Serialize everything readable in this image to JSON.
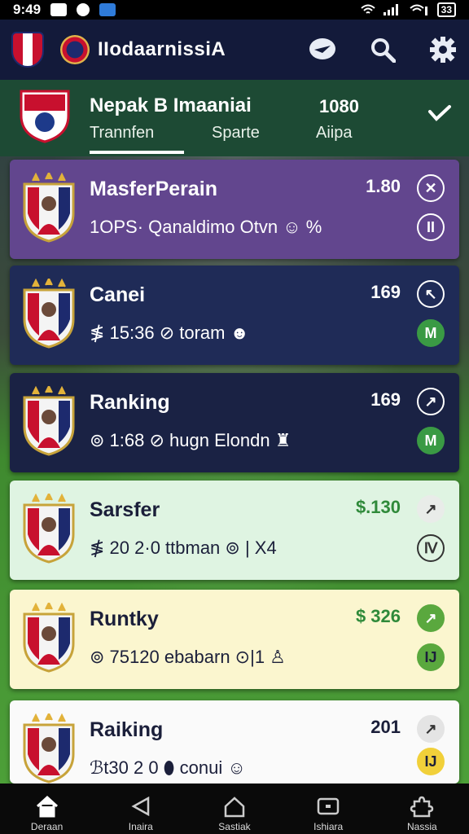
{
  "status_bar": {
    "time": "9:49",
    "battery": "33"
  },
  "app": {
    "title": "IIodaarnissiA"
  },
  "match": {
    "team": "Nepak B Imaaniai",
    "score": "1080",
    "tabs": [
      "Trannfen",
      "Sparte",
      "Aiipa"
    ],
    "active_tab": 0
  },
  "cards": [
    {
      "name": "MasferPerain",
      "meta": "1OPS· Qanaldimo Otvn ☺ %",
      "num": "1.80",
      "bg": "#62468e",
      "fg": "#ffffff",
      "numColor": "#ffffff",
      "b1": "✕",
      "b2": "II",
      "b1bg": "transparent",
      "b1fg": "#ffffff",
      "b2bg": "transparent",
      "b2fg": "#ffffff"
    },
    {
      "name": "Canei",
      "meta": "≸ 15:36  ⊘ toram  ☻",
      "num": "169",
      "bg": "#1f2b57",
      "fg": "#ffffff",
      "numColor": "#ffffff",
      "b1": "↖",
      "b2": "M",
      "b1bg": "transparent",
      "b1fg": "#ffffff",
      "b2bg": "#3a9a44",
      "b2fg": "#ffffff"
    },
    {
      "name": "Ranking",
      "meta": "⊚ 1:68  ⊘ hugn  Elondn  ♜",
      "num": "169",
      "bg": "#1a2244",
      "fg": "#ffffff",
      "numColor": "#ffffff",
      "b1": "↗",
      "b2": "M",
      "b1bg": "transparent",
      "b1fg": "#ffffff",
      "b2bg": "#3a9a44",
      "b2fg": "#ffffff"
    },
    {
      "name": "Sarsfer",
      "meta": "≸ 20  2·0  ttbman  ⊚ | X4",
      "num": "$.130",
      "bg": "#dff4e2",
      "fg": "#1b1f3a",
      "numColor": "#2f8a3a",
      "b1": "↗",
      "b2": "Ⅳ",
      "b1bg": "#e9ece9",
      "b1fg": "#333333",
      "b2bg": "transparent",
      "b2fg": "#333333"
    },
    {
      "name": "Runtky",
      "meta": "⊚ 75120  ebabarn  ⊙|1  ♙",
      "num": "$ 326",
      "bg": "#fbf6cf",
      "fg": "#1b1f3a",
      "numColor": "#2f8a3a",
      "b1": "↗",
      "b2": "IJ",
      "b1bg": "#5aa83e",
      "b1fg": "#ffffff",
      "b2bg": "#5aa83e",
      "b2fg": "#1b1f3a"
    },
    {
      "name": "Raiking",
      "meta": "ℬt30  2 0  ⬮ conui  ☺",
      "num": "201",
      "bg": "#fafafa",
      "fg": "#1b1f3a",
      "numColor": "#1b1f3a",
      "b1": "↗",
      "b2": "IJ",
      "b1bg": "#e4e4e4",
      "b1fg": "#333333",
      "b2bg": "#f1d03a",
      "b2fg": "#1b1f3a"
    }
  ],
  "bottom_nav": [
    {
      "label": "Deraan",
      "icon": "home-icon"
    },
    {
      "label": "Inaira",
      "icon": "back-icon"
    },
    {
      "label": "Sastiak",
      "icon": "house-outline-icon"
    },
    {
      "label": "Ishiara",
      "icon": "tv-icon"
    },
    {
      "label": "Nassia",
      "icon": "puzzle-icon"
    }
  ]
}
